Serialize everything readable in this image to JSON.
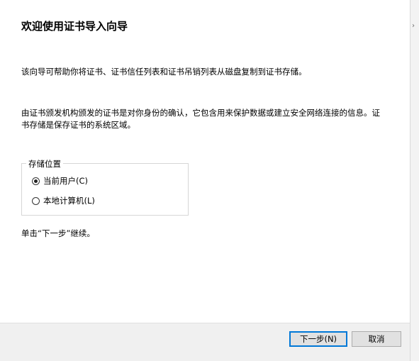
{
  "wizard": {
    "title": "欢迎使用证书导入向导",
    "intro": "该向导可帮助你将证书、证书信任列表和证书吊销列表从磁盘复制到证书存储。",
    "description": "由证书颁发机构颁发的证书是对你身份的确认，它包含用来保护数据或建立安全网络连接的信息。证书存储是保存证书的系统区域。",
    "store_location": {
      "legend": "存储位置",
      "options": [
        {
          "label": "当前用户(C)",
          "selected": true
        },
        {
          "label": "本地计算机(L)",
          "selected": false
        }
      ]
    },
    "continue_hint": "单击“下一步”继续。"
  },
  "footer": {
    "next_label": "下一步(N)",
    "cancel_label": "取消"
  },
  "side_strip": {
    "chevron": "›"
  },
  "colors": {
    "accent": "#0078d7",
    "footer_bg": "#f0f0f0"
  }
}
